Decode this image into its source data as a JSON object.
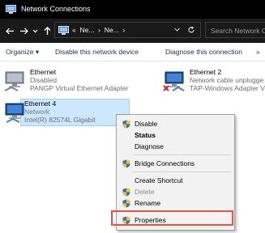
{
  "window": {
    "title": "Network Connections",
    "app_icon": "network-connections-icon"
  },
  "nav": {
    "back_glyph": "←",
    "forward_glyph": "→",
    "recent_glyph": "⌄",
    "up_glyph": "↑"
  },
  "address": {
    "prefix": "«",
    "crumb1": "Ne...",
    "sep1": "›",
    "crumb2": "Ne...",
    "sep2": "›",
    "dropdown_glyph": "⌄",
    "refresh_glyph": "↻"
  },
  "search": {
    "placeholder": "Search Network Co"
  },
  "command_bar": {
    "organize": "Organize ▾",
    "disable": "Disable this network device",
    "diagnose": "Diagnose this connection",
    "more": "»"
  },
  "adapters": [
    {
      "name": "Ethernet",
      "status": "Disabled",
      "device": "PANGP Virtual Ethernet Adapter",
      "icon": "network-adapter-disabled-icon"
    },
    {
      "name": "Ethernet 2",
      "status": "Network cable unplugge",
      "device": "TAP-Windows Adapter V",
      "icon": "network-adapter-unplugged-icon"
    },
    {
      "name": "Ethernet 4",
      "status": "Network",
      "device": "Intel(R) 82574L Gigabit",
      "icon": "network-adapter-connected-icon"
    }
  ],
  "context_menu": {
    "disable": "Disable",
    "status": "Status",
    "diagnose": "Diagnose",
    "bridge": "Bridge Connections",
    "shortcut": "Create Shortcut",
    "delete": "Delete",
    "rename": "Rename",
    "properties": "Properties"
  },
  "colors": {
    "titlebar": "#000000",
    "addressbar": "#191919",
    "selection": "#cce8ff",
    "highlight": "#e5563f"
  }
}
